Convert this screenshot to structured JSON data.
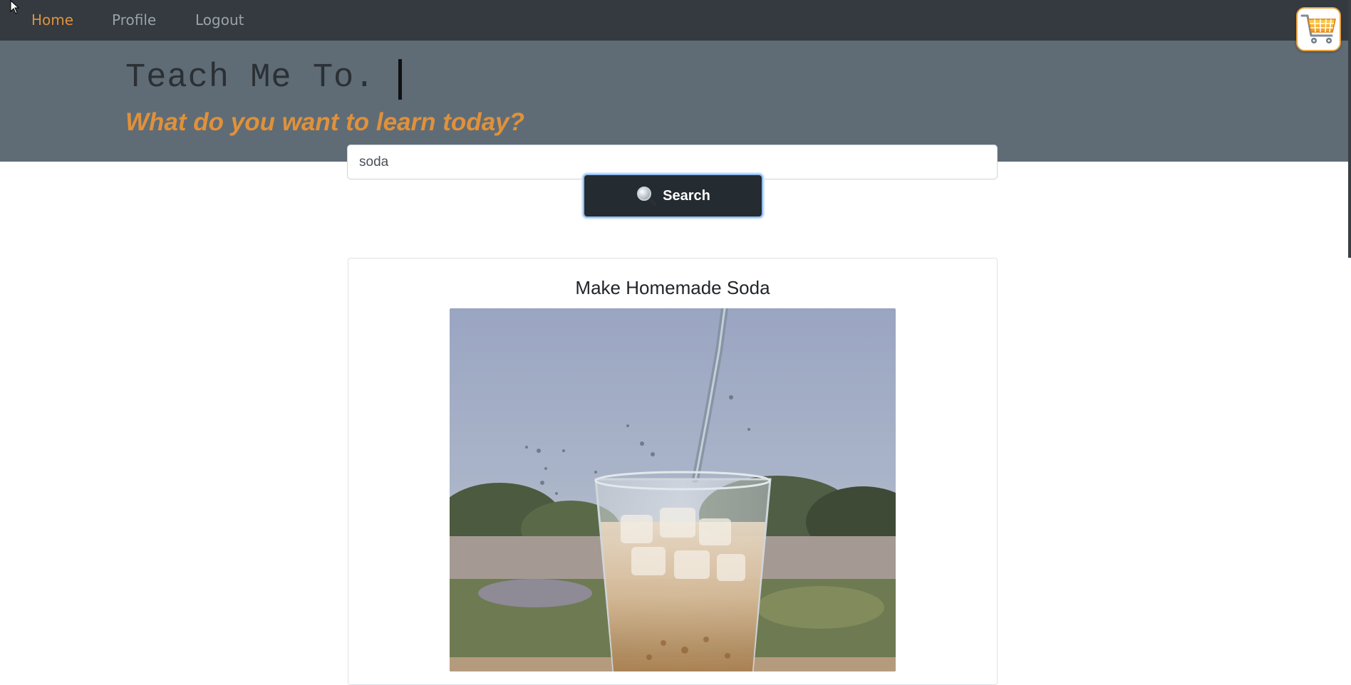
{
  "nav": {
    "items": [
      {
        "label": "Home",
        "active": true
      },
      {
        "label": "Profile",
        "active": false
      },
      {
        "label": "Logout",
        "active": false
      }
    ],
    "cart_icon": "shopping-cart-icon"
  },
  "hero": {
    "title": "Teach Me To.",
    "tagline": "What do you want to learn today?"
  },
  "search": {
    "value": "soda",
    "button_label": "Search",
    "button_icon": "magnifier-icon"
  },
  "results": [
    {
      "title": "Make Homemade Soda",
      "image": "soda-pouring-into-glass-photo"
    }
  ],
  "colors": {
    "navbar": "#343a40",
    "hero": "#5f6c76",
    "accent": "#e0913a",
    "button": "#242b31"
  }
}
